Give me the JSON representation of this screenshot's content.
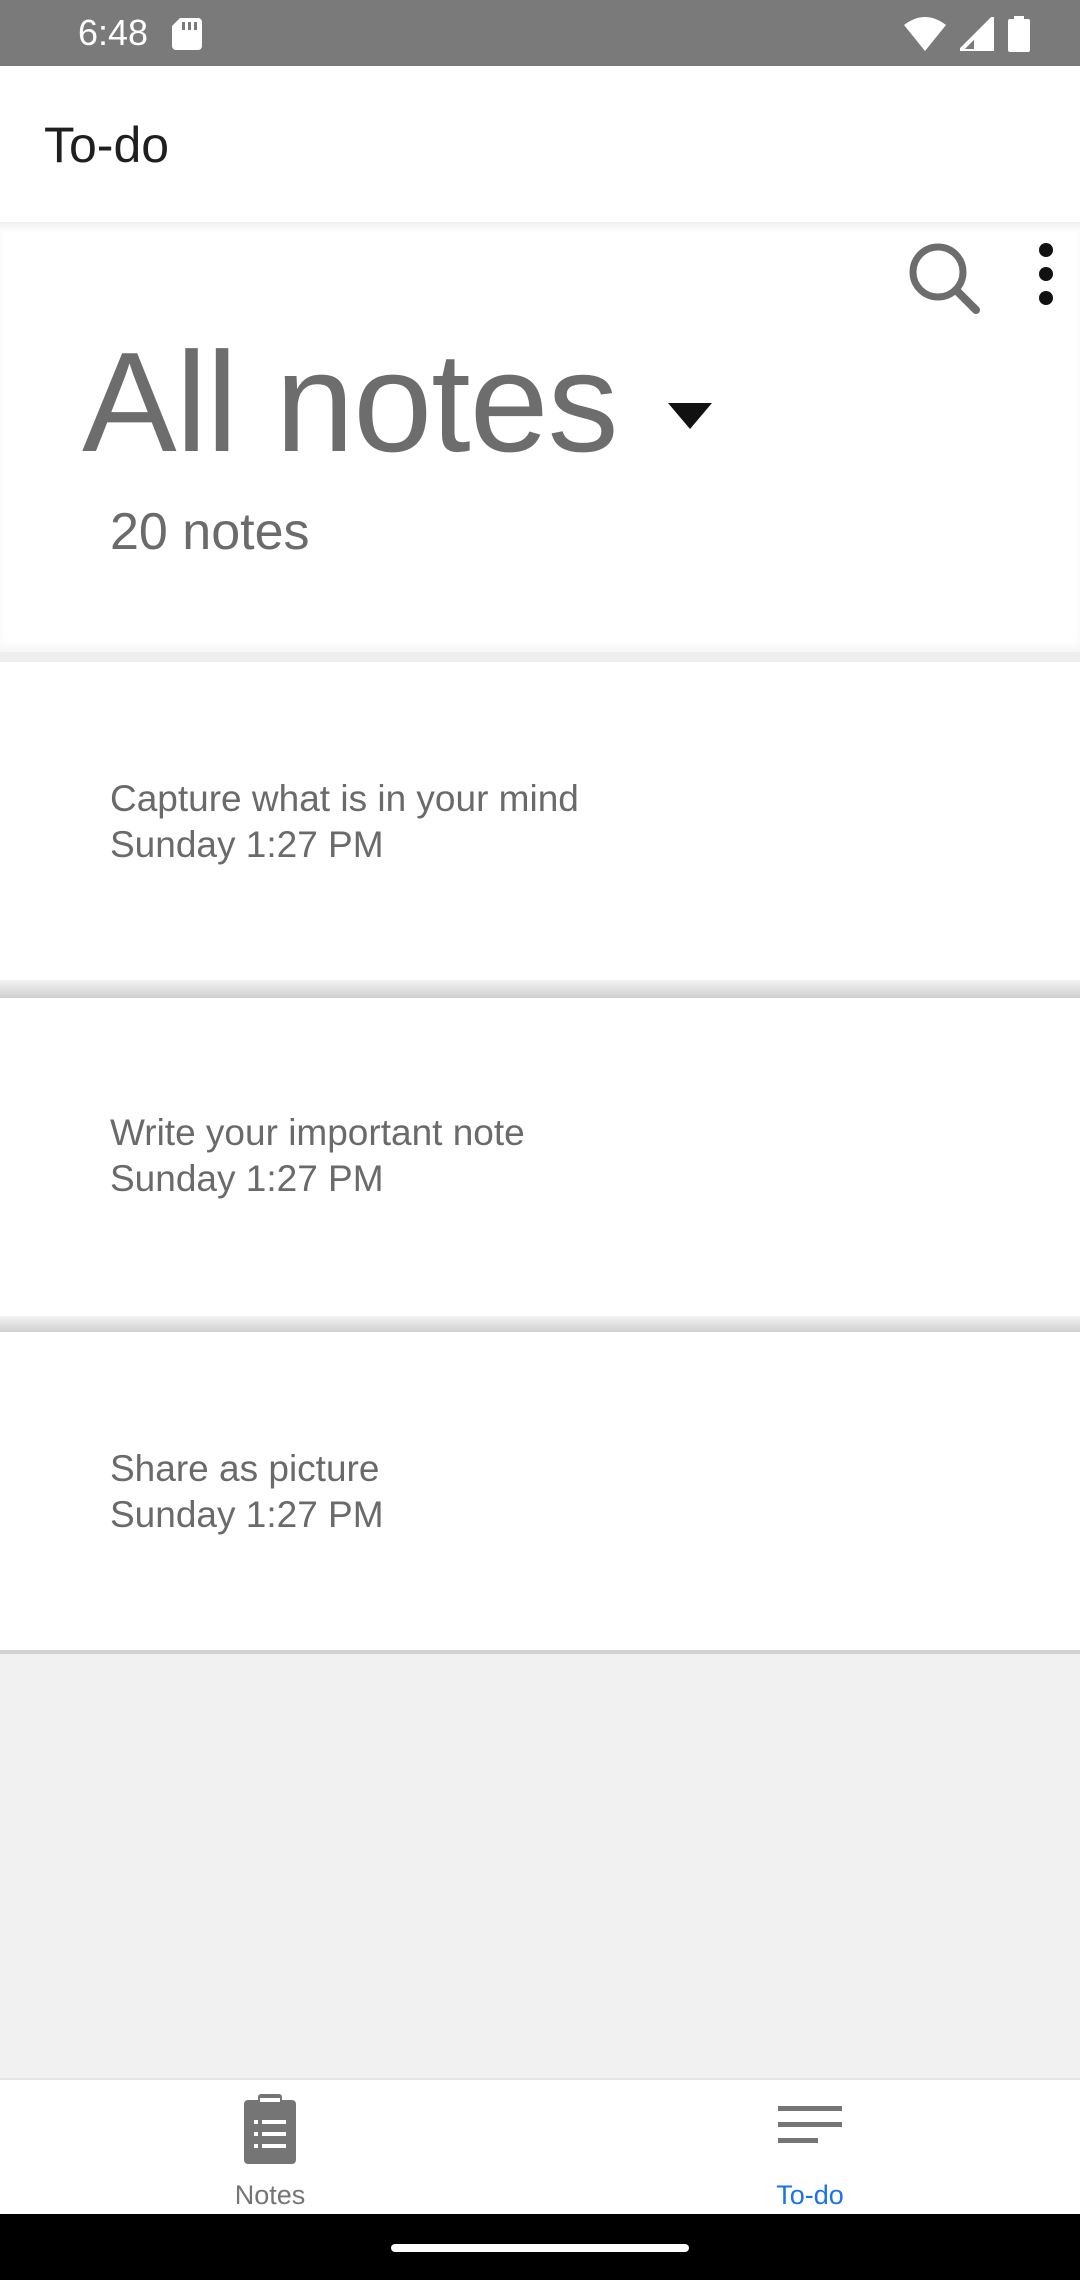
{
  "status_bar": {
    "time": "6:48",
    "icons": [
      "sd-card-icon",
      "wifi-icon",
      "signal-icon",
      "battery-icon"
    ]
  },
  "app_bar": {
    "title": "To-do"
  },
  "header": {
    "heading": "All notes",
    "count": "20 notes",
    "actions": [
      "search-icon",
      "more-vert-icon",
      "dropdown-arrow-icon"
    ]
  },
  "notes": [
    {
      "title": "Capture what is in your mind",
      "date": "Sunday 1:27 PM"
    },
    {
      "title": "Write your important note",
      "date": "Sunday 1:27 PM"
    },
    {
      "title": "Share as picture",
      "date": "Sunday 1:27 PM"
    }
  ],
  "bottom_nav": {
    "items": [
      {
        "label": "Notes",
        "icon": "clipboard-icon",
        "active": false
      },
      {
        "label": "To-do",
        "icon": "list-icon",
        "active": true
      }
    ]
  },
  "colors": {
    "accent": "#1a73e8",
    "status_bar": "#7a7a7a",
    "inactive": "#757575",
    "background": "#f1f1f1"
  }
}
